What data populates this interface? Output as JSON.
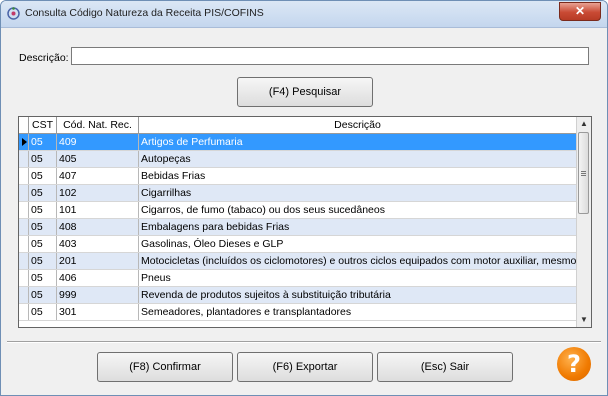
{
  "window": {
    "title": "Consulta Código Natureza da Receita PIS/COFINS",
    "close_label": "✕"
  },
  "search": {
    "label": "Descrição:",
    "value": "",
    "button_label": "(F4) Pesquisar"
  },
  "table": {
    "columns": [
      "CST",
      "Cód. Nat. Rec.",
      "Descrição"
    ],
    "selected_row": 0,
    "rows": [
      {
        "cst": "05",
        "cod": "409",
        "desc": "Artigos de Perfumaria"
      },
      {
        "cst": "05",
        "cod": "405",
        "desc": "Autopeças"
      },
      {
        "cst": "05",
        "cod": "407",
        "desc": "Bebidas Frias"
      },
      {
        "cst": "05",
        "cod": "102",
        "desc": "Cigarrilhas"
      },
      {
        "cst": "05",
        "cod": "101",
        "desc": "Cigarros, de fumo (tabaco) ou dos seus sucedâneos"
      },
      {
        "cst": "05",
        "cod": "408",
        "desc": "Embalagens para bebidas Frias"
      },
      {
        "cst": "05",
        "cod": "403",
        "desc": "Gasolinas, Óleo Dieses e GLP"
      },
      {
        "cst": "05",
        "cod": "201",
        "desc": "Motocicletas (incluídos os ciclomotores) e outros ciclos equipados com motor auxiliar, mesmo"
      },
      {
        "cst": "05",
        "cod": "406",
        "desc": "Pneus"
      },
      {
        "cst": "05",
        "cod": "999",
        "desc": "Revenda de produtos sujeitos à substituição tributária"
      },
      {
        "cst": "05",
        "cod": "301",
        "desc": "Semeadores, plantadores e transplantadores"
      }
    ]
  },
  "footer": {
    "confirm_label": "(F8) Confirmar",
    "export_label": "(F6) Exportar",
    "exit_label": "(Esc) Sair",
    "help_label": "?"
  },
  "colors": {
    "selection": "#3399ff",
    "alt_row": "#dfe8f6",
    "help": "#f07a00"
  }
}
